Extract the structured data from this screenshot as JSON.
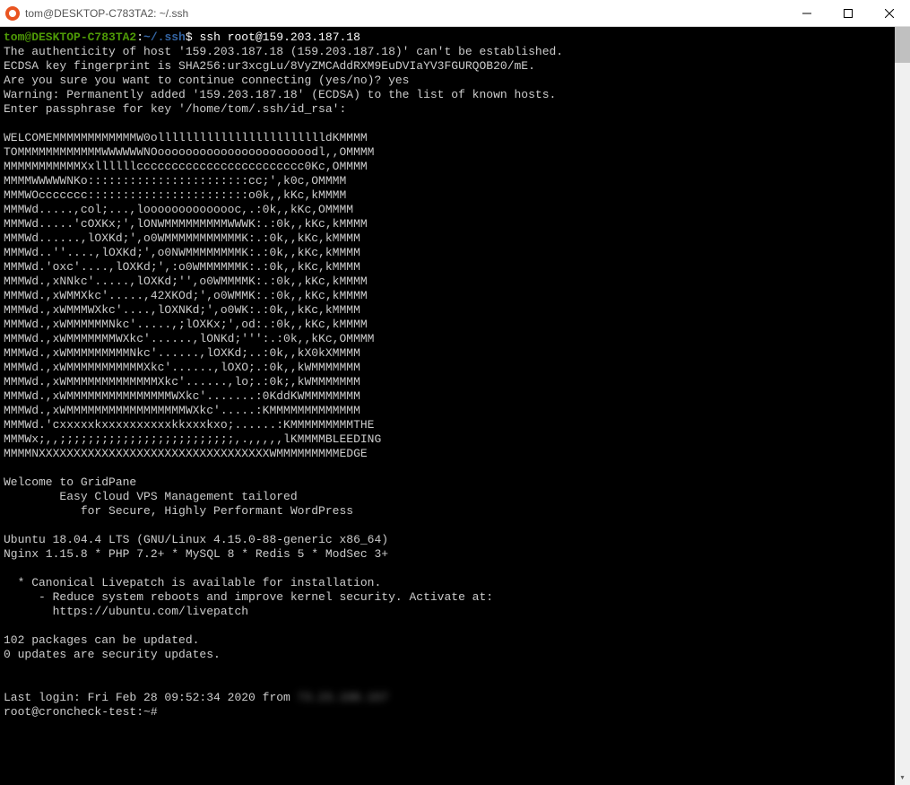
{
  "window": {
    "title": "tom@DESKTOP-C783TA2: ~/.ssh"
  },
  "prompt": {
    "user_host": "tom@DESKTOP-C783TA2",
    "colon": ":",
    "path": "~/.ssh",
    "dollar": "$ ",
    "command": "ssh root@159.203.187.18"
  },
  "lines": {
    "l1": "The authenticity of host '159.203.187.18 (159.203.187.18)' can't be established.",
    "l2": "ECDSA key fingerprint is SHA256:ur3xcgLu/8VyZMCAddRXM9EuDVIaYV3FGURQOB20/mE.",
    "l3": "Are you sure you want to continue connecting (yes/no)? yes",
    "l4": "Warning: Permanently added '159.203.187.18' (ECDSA) to the list of known hosts.",
    "l5": "Enter passphrase for key '/home/tom/.ssh/id_rsa':",
    "blank1": "",
    "a1": "WELCOMEMMMMMMMMMMMMW0olllllllllllllllllllllllldKMMMM",
    "a2": "TOMMMMMMMMMMMMWWWWWWNOoooooooooooooooooooooodl,,OMMMM",
    "a3": "MMMMMMMMMMMXxllllllcccccccccccccccccccccccc0Kc,OMMMM",
    "a4": "MMMMWWWWWNKo:::::::::::::::::::::::cc;',k0c,OMMMM",
    "a5": "MMMWOccccccc:::::::::::::::::::::::o0k,,kKc,kMMMM",
    "a6": "MMMWd.....,col;...,loooooooooooooc,.:0k,,kKc,OMMMM",
    "a7": "MMMWd.....'cOXKx;',lONWMMMMMMMMMWWWK:.:0k,,kKc,kMMMM",
    "a8": "MMMWd......,lOXKd;',o0WMMMMMMMMMMMK:.:0k,,kKc,kMMMM",
    "a9": "MMMWd..''....,lOXKd;',o0NWMMMMMMMMK:.:0k,,kKc,kMMMM",
    "a10": "MMMWd.'oxc'....,lOXKd;',:o0WMMMMMMK:.:0k,,kKc,kMMMM",
    "a11": "MMMWd.,xNNkc'.....,lOXKd;'',o0WMMMMK:.:0k,,kKc,kMMMM",
    "a12": "MMMWd.,xWMMXkc'.....,42XKOd;',o0WMMK:.:0k,,kKc,kMMMM",
    "a13": "MMMWd.,xWMMMWXkc'....,lOXNKd;',o0WK:.:0k,,kKc,kMMMM",
    "a14": "MMMWd.,xWMMMMMMNkc'.....,;lOXKx;',od:.:0k,,kKc,kMMMM",
    "a15": "MMMWd.,xWMMMMMMMWXkc'......,lONKd;''':.:0k,,kKc,OMMMM",
    "a16": "MMMWd.,xWMMMMMMMMMNkc'......,lOXKd;..:0k,,kX0kXMMMM",
    "a17": "MMMWd.,xWMMMMMMMMMMMXkc'......,lOXO;.:0k,,kWMMMMMMM",
    "a18": "MMMWd.,xWMMMMMMMMMMMMMXkc'......,lo;.:0k;,kWMMMMMMM",
    "a19": "MMMWd.,xWMMMMMMMMMMMMMMMWXkc'.......:0KddKWMMMMMMMM",
    "a20": "MMMWd.,xWMMMMMMMMMMMMMMMMMWXkc'.....:KMMMMMMMMMMMMM",
    "a21": "MMMWd.'cxxxxxkxxxxxxxxxxkkxxxkxo;......:KMMMMMMMMMTHE",
    "a22": "MMMWx;,,;;;;;;;;;;;;;;;;;;;;;;;;;,.,,,,,lKMMMMBLEEDING",
    "a23": "MMMMNXXXXXXXXXXXXXXXXXXXXXXXXXXXXXXXXXWMMMMMMMMMEDGE",
    "blank2": "",
    "w1": "Welcome to GridPane",
    "w2": "        Easy Cloud VPS Management tailored",
    "w3": "           for Secure, Highly Performant WordPress",
    "blank3": "",
    "s1": "Ubuntu 18.04.4 LTS (GNU/Linux 4.15.0-88-generic x86_64)",
    "s2": "Nginx 1.15.8 * PHP 7.2+ * MySQL 8 * Redis 5 * ModSec 3+",
    "blank4": "",
    "lp1": "  * Canonical Livepatch is available for installation.",
    "lp2": "     - Reduce system reboots and improve kernel security. Activate at:",
    "lp3": "       https://ubuntu.com/livepatch",
    "blank5": "",
    "pk1": "102 packages can be updated.",
    "pk2": "0 updates are security updates.",
    "blank6": "",
    "blank7": "",
    "ll_prefix": "Last login: Fri Feb 28 09:52:34 2020 from ",
    "ll_blur": "73.23.198.157",
    "endprompt": "root@croncheck-test:~# "
  }
}
